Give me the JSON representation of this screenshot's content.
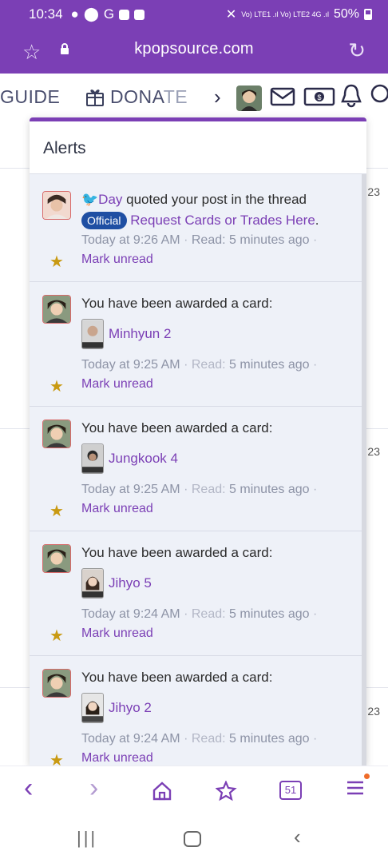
{
  "status_bar": {
    "time": "10:34",
    "network": "Vo) LTE1 .ıl Vo) LTE2 4G .ıl",
    "battery": "50%"
  },
  "url_bar": {
    "url": "kpopsource.com",
    "bookmark_icon": "star-outline-icon",
    "reload_icon": "reload-icon"
  },
  "site_nav": {
    "guide": "GUIDE",
    "donate_a": "DONA",
    "donate_b": "TE",
    "chevron": "›"
  },
  "background": {
    "nums": [
      "23",
      "23",
      "23"
    ]
  },
  "alerts": {
    "title": "Alerts",
    "items": [
      {
        "type": "quote",
        "user": "Day",
        "action": " quoted your post in the thread ",
        "badge": "Official",
        "thread": "Request Cards or Trades Here",
        "punct": ".",
        "time": "Today at 9:26 AM",
        "read_label": "Read:",
        "read_value": "5 minutes ago",
        "sep": "·",
        "mark_unread": "Mark unread"
      },
      {
        "type": "card",
        "text": "You have been awarded a card:",
        "card": "Minhyun 2",
        "time": "Today at 9:25 AM",
        "read_label": "Read:",
        "read_value": "5 minutes ago",
        "sep": "·",
        "mark_unread": "Mark unread"
      },
      {
        "type": "card",
        "text": "You have been awarded a card:",
        "card": "Jungkook 4",
        "time": "Today at 9:25 AM",
        "read_label": "Read:",
        "read_value": "5 minutes ago",
        "sep": "·",
        "mark_unread": "Mark unread"
      },
      {
        "type": "card",
        "text": "You have been awarded a card:",
        "card": "Jihyo 5",
        "time": "Today at 9:24 AM",
        "read_label": "Read:",
        "read_value": "5 minutes ago",
        "sep": "·",
        "mark_unread": "Mark unread"
      },
      {
        "type": "card",
        "text": "You have been awarded a card:",
        "card": "Jihyo 2",
        "time": "Today at 9:24 AM",
        "read_label": "Read:",
        "read_value": "5 minutes ago",
        "sep": "·",
        "mark_unread": "Mark unread"
      }
    ]
  },
  "toolbar": {
    "back": "‹",
    "forward": "›",
    "tabs_count": "51"
  },
  "colors": {
    "brand": "#7b3fb5",
    "badge": "#1f4fa3",
    "star": "#c99a12"
  }
}
